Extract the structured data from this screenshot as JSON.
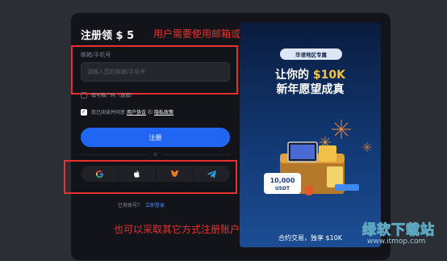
{
  "form": {
    "title": "注册领 $ 5",
    "field_label": "邮箱/手机号",
    "field_placeholder": "请输入您的邮箱/手机号",
    "field_value": "",
    "referral_label": "填写推广码（选填）",
    "agree_prefix": "我已阅读并同意",
    "terms_link": "用户协议",
    "agree_and": "和",
    "privacy_link": "隐私政策",
    "signup_button": "注册",
    "or_text": "或",
    "social_icons": [
      "google-icon",
      "apple-icon",
      "metamask-icon",
      "telegram-icon"
    ],
    "login_prompt": "已有账号？",
    "login_link": "立即登录"
  },
  "annotations": {
    "top": "用户需要使用邮箱或手机号注册账户",
    "bottom": "也可以采取其它方式注册账户"
  },
  "promo": {
    "region_tag": "华语地区专属",
    "line1_prefix": "让你的",
    "line1_highlight": "$10K",
    "line2": "新年愿望成真",
    "coupon_value": "10,000",
    "coupon_unit": "USDT",
    "caption": "合约交易，独享 $10K"
  },
  "watermark": {
    "name": "绿软下载站",
    "url": "www.itmop.com"
  },
  "colors": {
    "primary_button": "#2166f3",
    "annotation_red": "#e8312f",
    "promo_highlight": "#f6c343",
    "link_blue": "#4a86ff"
  }
}
